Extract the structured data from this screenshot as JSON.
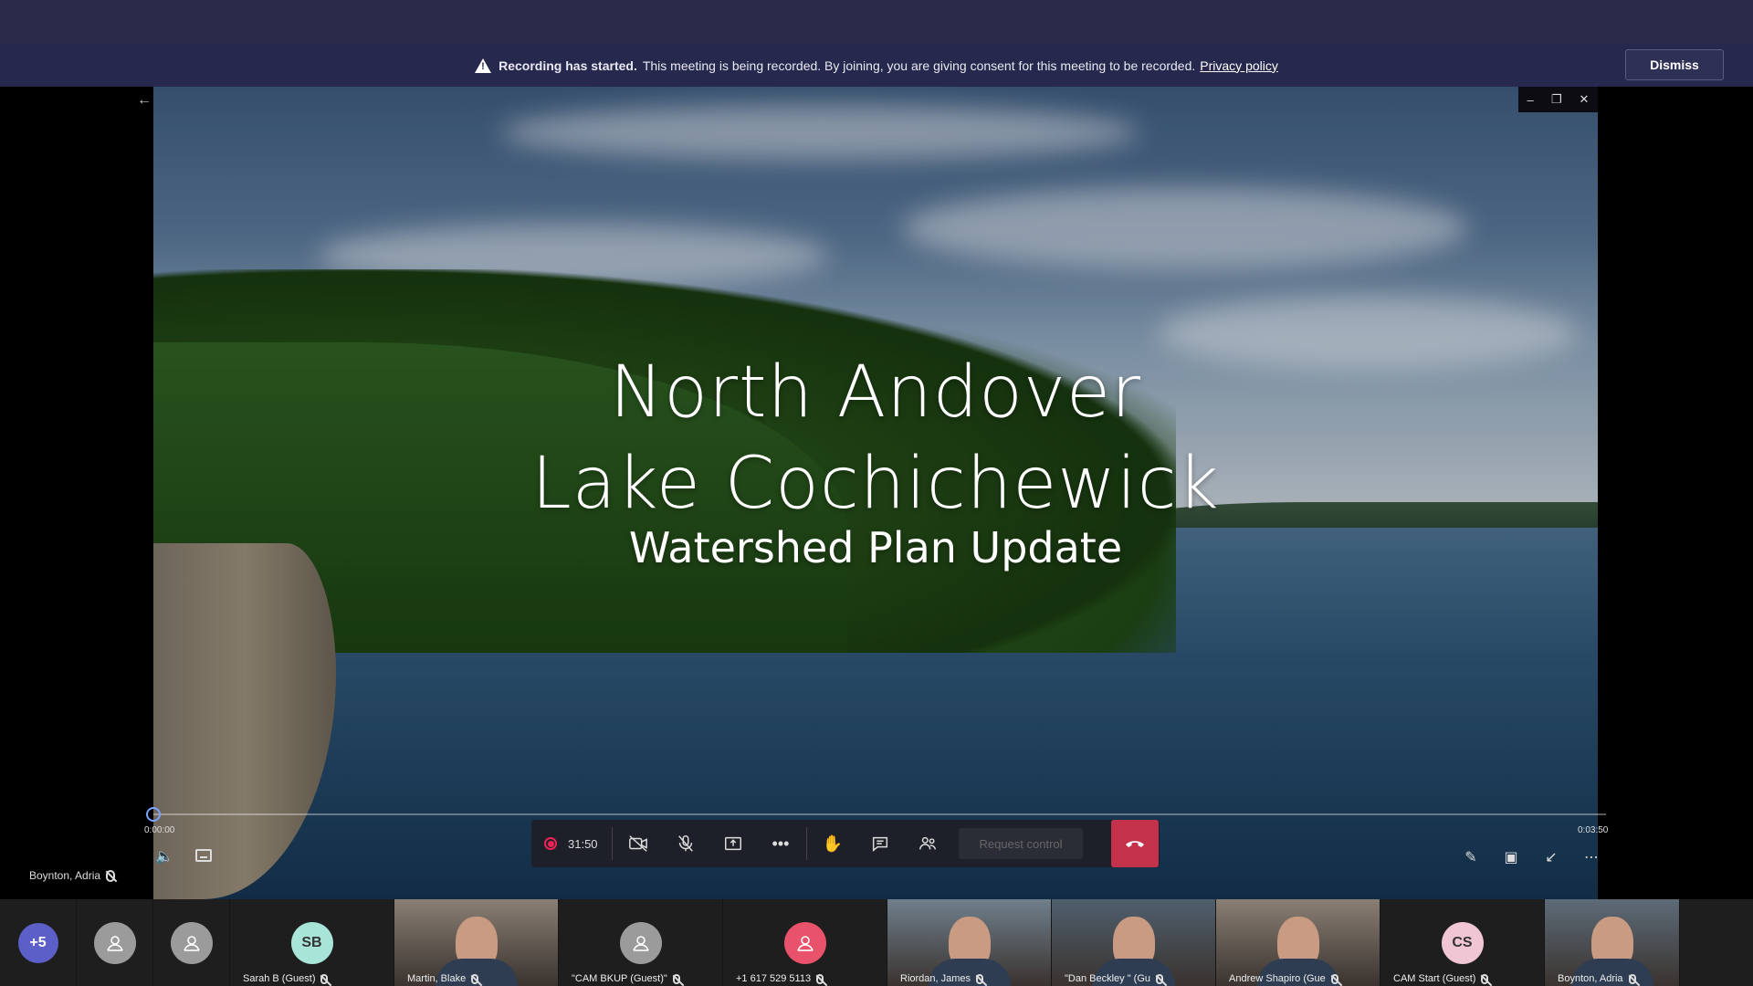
{
  "banner": {
    "bold": "Recording has started.",
    "message": "This meeting is being recorded. By joining, you are giving consent for this meeting to be recorded.",
    "link": "Privacy policy",
    "dismiss": "Dismiss"
  },
  "slide": {
    "line1": "North Andover",
    "line2": "Lake Cochichewick",
    "line3": "Watershed Plan Update"
  },
  "playback": {
    "start": "0:00:00",
    "end": "0:03:50",
    "progress": 0.0
  },
  "presenter": {
    "name": "Boynton, Adria"
  },
  "callbar": {
    "timer": "31:50",
    "request_control": "Request control"
  },
  "colors": {
    "banner_bg": "#26284d",
    "hangup": "#c4314b",
    "titlebar": "#2b2a4a"
  },
  "participants": [
    {
      "type": "overflow",
      "label": "+5",
      "color": "#5b5fc7"
    },
    {
      "type": "generic",
      "name": ""
    },
    {
      "type": "generic",
      "name": ""
    },
    {
      "type": "initials",
      "initials": "SB",
      "color": "#a9e4d8",
      "name": "Sarah B (Guest)"
    },
    {
      "type": "video",
      "name": "Martin, Blake"
    },
    {
      "type": "generic",
      "name": "\"CAM BKUP (Guest)\""
    },
    {
      "type": "phone",
      "name": "+1 617 529 5113",
      "color": "#e8526a"
    },
    {
      "type": "video",
      "name": "Riordan, James"
    },
    {
      "type": "video",
      "name": "\"Dan Beckley \" (Gu"
    },
    {
      "type": "video",
      "name": "Andrew Shapiro (Gue"
    },
    {
      "type": "initials",
      "initials": "CS",
      "color": "#f0c6d4",
      "name": "CAM Start (Guest)"
    },
    {
      "type": "video",
      "name": "Boynton, Adria"
    }
  ]
}
